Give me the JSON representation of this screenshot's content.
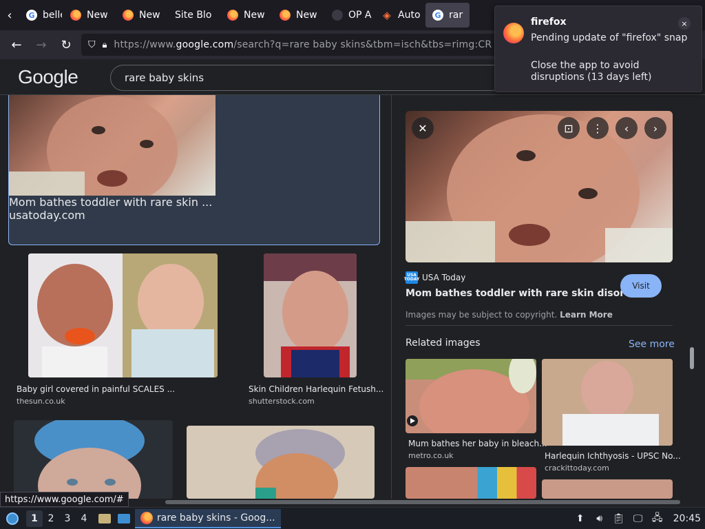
{
  "browser": {
    "tabs": [
      {
        "label": "belle",
        "icon": "google-icon"
      },
      {
        "label": "New",
        "icon": "firefox-icon"
      },
      {
        "label": "New",
        "icon": "firefox-icon"
      },
      {
        "label": "Site Blo",
        "icon": "none"
      },
      {
        "label": "New",
        "icon": "firefox-icon"
      },
      {
        "label": "New",
        "icon": "firefox-icon"
      },
      {
        "label": "OP A",
        "icon": "dark-icon"
      },
      {
        "label": "Auto",
        "icon": "auto-icon"
      },
      {
        "label": "rar",
        "icon": "google-icon",
        "active": true
      }
    ],
    "url_prefix": "https://www.",
    "url_host": "google.com",
    "url_rest": "/search?q=rare baby skins&tbm=isch&tbs=rimg:CR",
    "status_url": "https://www.google.com/#"
  },
  "google": {
    "logo": "Google",
    "query": "rare baby skins"
  },
  "results": [
    {
      "title": "Mom bathes toddler with rare skin ...",
      "site": "usatoday.com"
    },
    {
      "title": "Baby girl covered in painful SCALES ...",
      "site": "thesun.co.uk"
    },
    {
      "title": "Skin Children Harlequin Fetush...",
      "site": "shutterstock.com"
    }
  ],
  "panel": {
    "source_name": "USA Today",
    "source_badge": "USA TODAY",
    "title": "Mom bathes toddler with rare skin disorde...",
    "visit_label": "Visit",
    "copyright_text": "Images may be subject to copyright.",
    "learn_more": "Learn More",
    "related_heading": "Related images",
    "see_more": "See more",
    "related": [
      {
        "title": "Mum bathes her baby in bleach...",
        "site": "metro.co.uk"
      },
      {
        "title": "Harlequin Ichthyosis - UPSC No...",
        "site": "crackittoday.com"
      }
    ]
  },
  "notification": {
    "app": "firefox",
    "line1": "Pending update of \"firefox\" snap",
    "line2": "Close the app to avoid disruptions (13 days left)",
    "close": "×"
  },
  "taskbar": {
    "workspaces": [
      "1",
      "2",
      "3",
      "4"
    ],
    "app_title": "rare baby skins - Goog...",
    "clock": "20:45"
  },
  "colors": {
    "accent": "#8ab4f8",
    "bg": "#202124",
    "firefox_chrome": "#2b2a33"
  }
}
